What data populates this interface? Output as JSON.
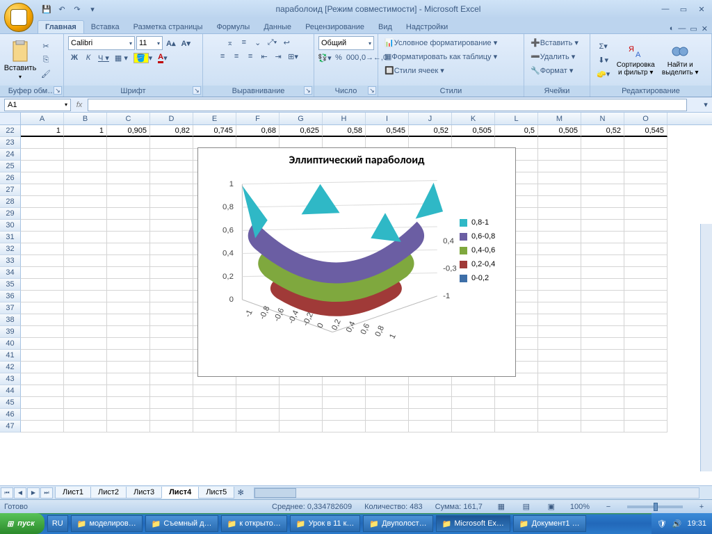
{
  "title": "параболоид  [Режим совместимости] - Microsoft Excel",
  "qat": {
    "save": "💾",
    "undo": "↶",
    "redo": "↷"
  },
  "tabs": [
    "Главная",
    "Вставка",
    "Разметка страницы",
    "Формулы",
    "Данные",
    "Рецензирование",
    "Вид",
    "Надстройки"
  ],
  "active_tab": 0,
  "groups": {
    "clipboard": {
      "title": "Буфер обм…",
      "paste": "Вставить"
    },
    "font": {
      "title": "Шрифт",
      "name": "Calibri",
      "size": "11"
    },
    "align": {
      "title": "Выравнивание"
    },
    "number": {
      "title": "Число",
      "format": "Общий"
    },
    "styles": {
      "title": "Стили",
      "cond": "Условное форматирование ▾",
      "table": "Форматировать как таблицу ▾",
      "cell": "Стили ячеек ▾"
    },
    "cells": {
      "title": "Ячейки",
      "insert": "Вставить ▾",
      "delete": "Удалить ▾",
      "format": "Формат ▾"
    },
    "editing": {
      "title": "Редактирование",
      "sort": "Сортировка\nи фильтр ▾",
      "find": "Найти и\nвыделить ▾"
    }
  },
  "name_box": "A1",
  "columns": [
    "A",
    "B",
    "C",
    "D",
    "E",
    "F",
    "G",
    "H",
    "I",
    "J",
    "K",
    "L",
    "M",
    "N",
    "O"
  ],
  "first_row_number": "22",
  "data_row": [
    "1",
    "1",
    "0,905",
    "0,82",
    "0,745",
    "0,68",
    "0,625",
    "0,58",
    "0,545",
    "0,52",
    "0,505",
    "0,5",
    "0,505",
    "0,52",
    "0,545"
  ],
  "row_numbers": [
    "22",
    "23",
    "24",
    "25",
    "26",
    "27",
    "28",
    "29",
    "30",
    "31",
    "32",
    "33",
    "34",
    "35",
    "36",
    "37",
    "38",
    "39",
    "40",
    "41",
    "42",
    "43",
    "44",
    "45",
    "46",
    "47"
  ],
  "chart_data": {
    "type": "surface3d",
    "title": "Эллиптический параболоид",
    "z_axis": {
      "min": 0,
      "max": 1,
      "ticks": [
        0,
        "0,2",
        "0,4",
        "0,6",
        "0,8",
        1
      ]
    },
    "x_axis_ticks": [
      "-1",
      "-0,8",
      "-0,6",
      "-0,4",
      "-0,2",
      "0",
      "0,2",
      "0,4",
      "0,6",
      "0,8",
      "1"
    ],
    "y_axis_ticks": [
      "-1",
      "-0,3",
      "0,4"
    ],
    "legend": [
      {
        "label": "0,8-1",
        "color": "#2fb8c6"
      },
      {
        "label": "0,6-0,8",
        "color": "#6b5ea3"
      },
      {
        "label": "0,4-0,6",
        "color": "#7fa83e"
      },
      {
        "label": "0,2-0,4",
        "color": "#a03a38"
      },
      {
        "label": "0-0,2",
        "color": "#3e6fa8"
      }
    ]
  },
  "sheets": [
    "Лист1",
    "Лист2",
    "Лист3",
    "Лист4",
    "Лист5"
  ],
  "active_sheet": 3,
  "status": {
    "ready": "Готово",
    "avg_lbl": "Среднее:",
    "avg": "0,334782609",
    "cnt_lbl": "Количество:",
    "cnt": "483",
    "sum_lbl": "Сумма:",
    "sum": "161,7",
    "zoom": "100%"
  },
  "taskbar": {
    "start": "пуск",
    "lang": "RU",
    "items": [
      "моделиров…",
      "Съемный д…",
      "к открыто…",
      "Урок в 11 к…",
      "Двуполост…",
      "Microsoft Ex…",
      "Документ1 …"
    ],
    "active_item": 5,
    "time": "19:31"
  }
}
